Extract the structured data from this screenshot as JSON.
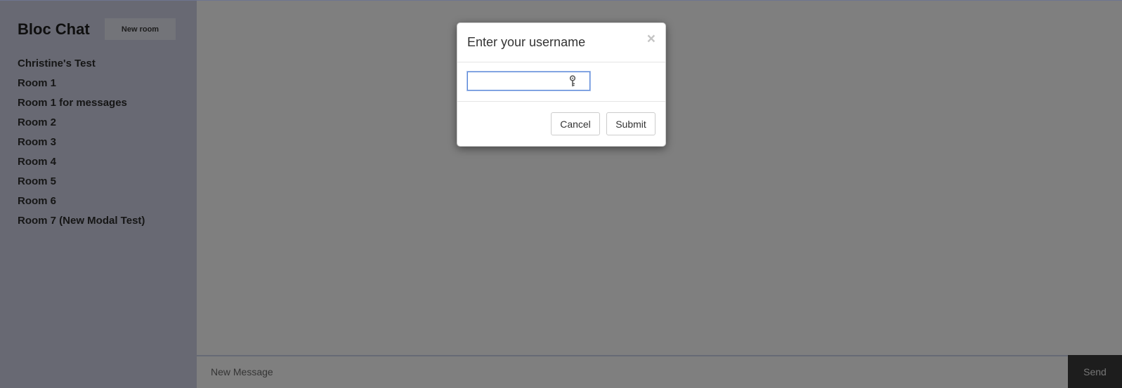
{
  "app": {
    "title": "Bloc Chat",
    "new_room_label": "New room"
  },
  "rooms": [
    {
      "name": "Christine's Test"
    },
    {
      "name": "Room 1"
    },
    {
      "name": "Room 1 for messages"
    },
    {
      "name": "Room 2"
    },
    {
      "name": "Room 3"
    },
    {
      "name": "Room 4"
    },
    {
      "name": "Room 5"
    },
    {
      "name": "Room 6"
    },
    {
      "name": "Room 7 (New Modal Test)"
    }
  ],
  "composer": {
    "placeholder": "New Message",
    "value": "",
    "send_label": "Send"
  },
  "modal": {
    "title": "Enter your username",
    "close_glyph": "×",
    "username_value": "",
    "cancel_label": "Cancel",
    "submit_label": "Submit",
    "input_icon": "key-icon"
  },
  "colors": {
    "sidebar_bg": "#d0d3e6",
    "backdrop": "rgba(0,0,0,0.5)",
    "send_bg": "#3b3b3b",
    "focus_border": "#5b88d8"
  }
}
